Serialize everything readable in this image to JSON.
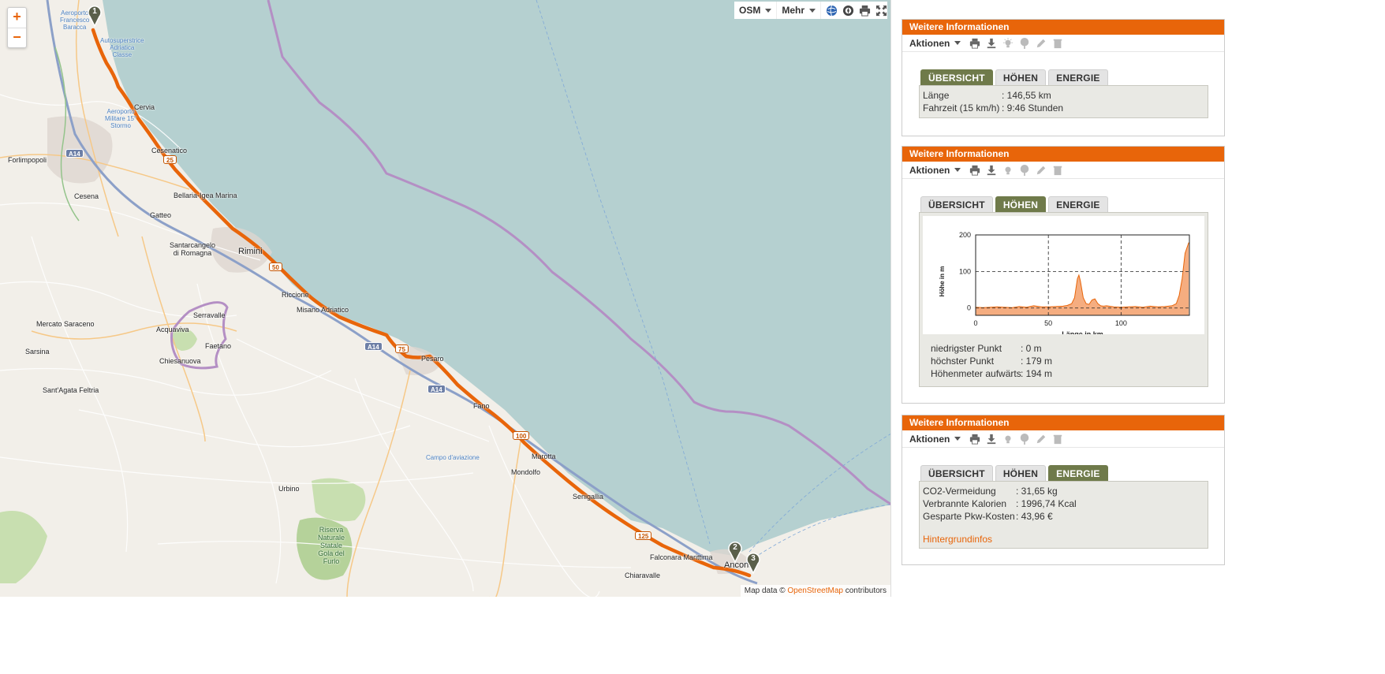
{
  "map": {
    "zoom_in": "+",
    "zoom_out": "−",
    "layer_label": "OSM",
    "more_label": "Mehr",
    "attribution_prefix": "Map data ©",
    "attribution_link": "OpenStreetMap",
    "attribution_suffix": "contributors",
    "places": [
      {
        "text": "Forlimpopoli",
        "cls": ""
      },
      {
        "text": "Cesena",
        "cls": ""
      },
      {
        "text": "Cervia",
        "cls": ""
      },
      {
        "text": "Cesenatico",
        "cls": ""
      },
      {
        "text": "Bellaria-Igea Marina",
        "cls": ""
      },
      {
        "text": "Gatteo",
        "cls": ""
      },
      {
        "text": "Santarcangelo\ndi Romagna",
        "cls": ""
      },
      {
        "text": "Rimini",
        "cls": "big"
      },
      {
        "text": "Riccione",
        "cls": ""
      },
      {
        "text": "Misano Adriatico",
        "cls": ""
      },
      {
        "text": "Serravalle",
        "cls": ""
      },
      {
        "text": "Acquaviva",
        "cls": ""
      },
      {
        "text": "Faetano",
        "cls": ""
      },
      {
        "text": "Chiesanuova",
        "cls": ""
      },
      {
        "text": "Mercato Saraceno",
        "cls": ""
      },
      {
        "text": "Sarsina",
        "cls": ""
      },
      {
        "text": "Sant'Agata Feltria",
        "cls": ""
      },
      {
        "text": "Pesaro",
        "cls": ""
      },
      {
        "text": "Fano",
        "cls": ""
      },
      {
        "text": "Marotta",
        "cls": ""
      },
      {
        "text": "Mondolfo",
        "cls": ""
      },
      {
        "text": "Senigallia",
        "cls": ""
      },
      {
        "text": "Urbino",
        "cls": ""
      },
      {
        "text": "Falconara Marittima",
        "cls": ""
      },
      {
        "text": "Chiaravalle",
        "cls": ""
      },
      {
        "text": "Ancona",
        "cls": "big"
      },
      {
        "text": "Aeroporto\nFrancesco\nBaracca",
        "cls": "blue"
      },
      {
        "text": "Autosuperstrice\nAdriatica\nClasse",
        "cls": "blue"
      },
      {
        "text": "Aeroporto\nMilitare 15°\nStormo",
        "cls": "blue"
      },
      {
        "text": "Campo d'aviazione",
        "cls": "blue"
      },
      {
        "text": "Riserva\nNaturale\nStatale\nGola del\nFurlo",
        "cls": "green"
      }
    ],
    "shields": [
      {
        "text": "A14",
        "type": "a"
      },
      {
        "text": "25",
        "type": "s"
      },
      {
        "text": "50",
        "type": "s"
      },
      {
        "text": "A14",
        "type": "a"
      },
      {
        "text": "75",
        "type": "s"
      },
      {
        "text": "A14",
        "type": "a"
      },
      {
        "text": "100",
        "type": "s"
      },
      {
        "text": "125",
        "type": "s"
      }
    ],
    "markers": [
      "1",
      "2",
      "3"
    ],
    "icons": [
      "globe-icon",
      "compass-icon",
      "print-icon",
      "fullscreen-icon"
    ]
  },
  "panels": [
    {
      "title": "Weitere Informationen",
      "actions_label": "Aktionen",
      "tabs": [
        "ÜBERSICHT",
        "HÖHEN",
        "ENERGIE"
      ],
      "active_tab": 0,
      "rows": [
        {
          "k": "Länge",
          "v": ": 146,55 km"
        },
        {
          "k": "Fahrzeit (15 km/h)",
          "v": ": 9:46 Stunden"
        }
      ]
    },
    {
      "title": "Weitere Informationen",
      "actions_label": "Aktionen",
      "tabs": [
        "ÜBERSICHT",
        "HÖHEN",
        "ENERGIE"
      ],
      "active_tab": 1,
      "rows": [
        {
          "k": "niedrigster Punkt",
          "v": ": 0 m"
        },
        {
          "k": "höchster Punkt",
          "v": ": 179 m"
        },
        {
          "k": "Höhenmeter aufwärts",
          "v": ": 194 m"
        }
      ]
    },
    {
      "title": "Weitere Informationen",
      "actions_label": "Aktionen",
      "tabs": [
        "ÜBERSICHT",
        "HÖHEN",
        "ENERGIE"
      ],
      "active_tab": 2,
      "rows": [
        {
          "k": "CO2-Vermeidung",
          "v": ": 31,65 kg"
        },
        {
          "k": "Verbrannte Kalorien",
          "v": ": 1996,74 Kcal"
        },
        {
          "k": "Gesparte Pkw-Kosten",
          "v": ": 43,96 €"
        }
      ],
      "link": "Hintergrundinfos"
    }
  ],
  "action_icons": [
    "print-icon",
    "download-icon",
    "lightbulb-icon",
    "tree-icon",
    "edit-icon",
    "trash-icon"
  ],
  "colors": {
    "accent": "#e8650a",
    "tab_active": "#6f7a4a",
    "route": "#e8650a",
    "sea": "#b5d0d0",
    "boundary": "#b48fc4"
  },
  "chart_data": {
    "type": "area",
    "xlabel": "Länge in km",
    "ylabel": "Höhe in m",
    "xlim": [
      0,
      147
    ],
    "ylim": [
      -20,
      200
    ],
    "xticks": [
      0,
      50,
      100
    ],
    "yticks": [
      0,
      100,
      200
    ],
    "grid": true,
    "x": [
      0,
      5,
      10,
      15,
      20,
      25,
      30,
      35,
      40,
      45,
      50,
      55,
      60,
      63,
      66,
      68,
      70,
      71,
      72,
      74,
      76,
      78,
      80,
      82,
      84,
      86,
      88,
      90,
      95,
      100,
      105,
      110,
      115,
      120,
      125,
      130,
      135,
      138,
      140,
      142,
      144,
      146.55
    ],
    "y": [
      2,
      1,
      2,
      3,
      2,
      1,
      4,
      2,
      6,
      3,
      3,
      4,
      5,
      7,
      12,
      28,
      80,
      90,
      75,
      28,
      12,
      10,
      22,
      25,
      12,
      6,
      5,
      6,
      3,
      2,
      3,
      4,
      2,
      5,
      3,
      4,
      6,
      12,
      35,
      80,
      150,
      179
    ]
  }
}
